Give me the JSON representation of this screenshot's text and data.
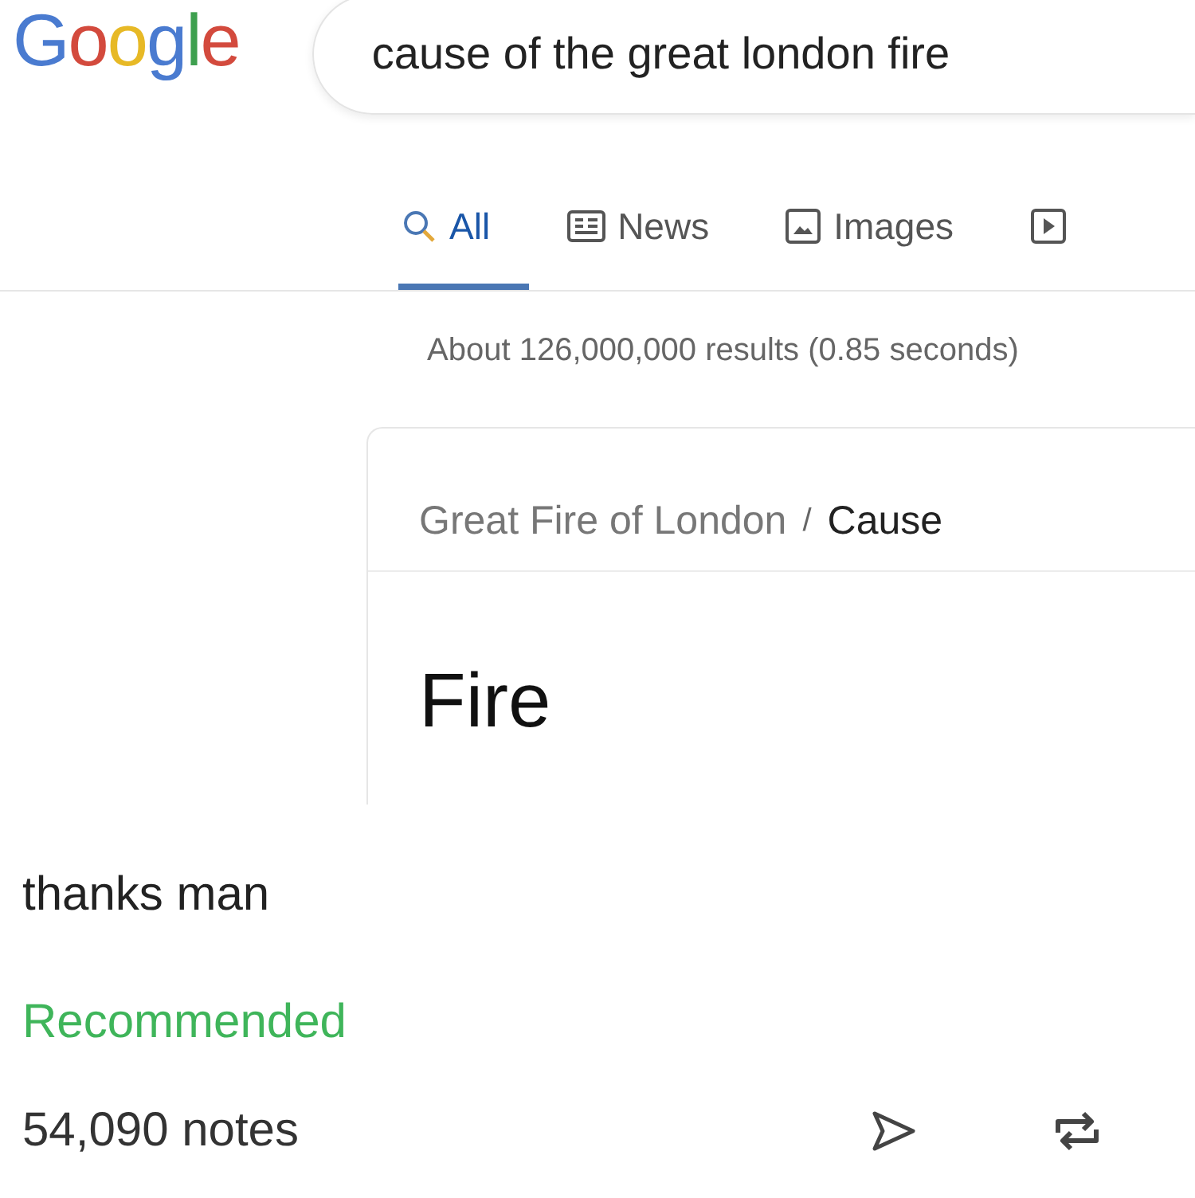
{
  "search": {
    "logo": "Google",
    "query": "cause of the great london fire"
  },
  "tabs": [
    {
      "kind": "search",
      "label": "All",
      "selected": true
    },
    {
      "kind": "news",
      "label": "News",
      "selected": false
    },
    {
      "kind": "images",
      "label": "Images",
      "selected": false
    },
    {
      "kind": "video",
      "selected": false
    }
  ],
  "result_stats": "About 126,000,000 results (0.85 seconds)",
  "answer_card": {
    "breadcrumb": [
      "Great Fire of London",
      "Cause"
    ],
    "separator": "/",
    "answer": "Fire"
  },
  "post": {
    "caption": "thanks man",
    "label": "Recommended",
    "notes": "54,090 notes"
  }
}
